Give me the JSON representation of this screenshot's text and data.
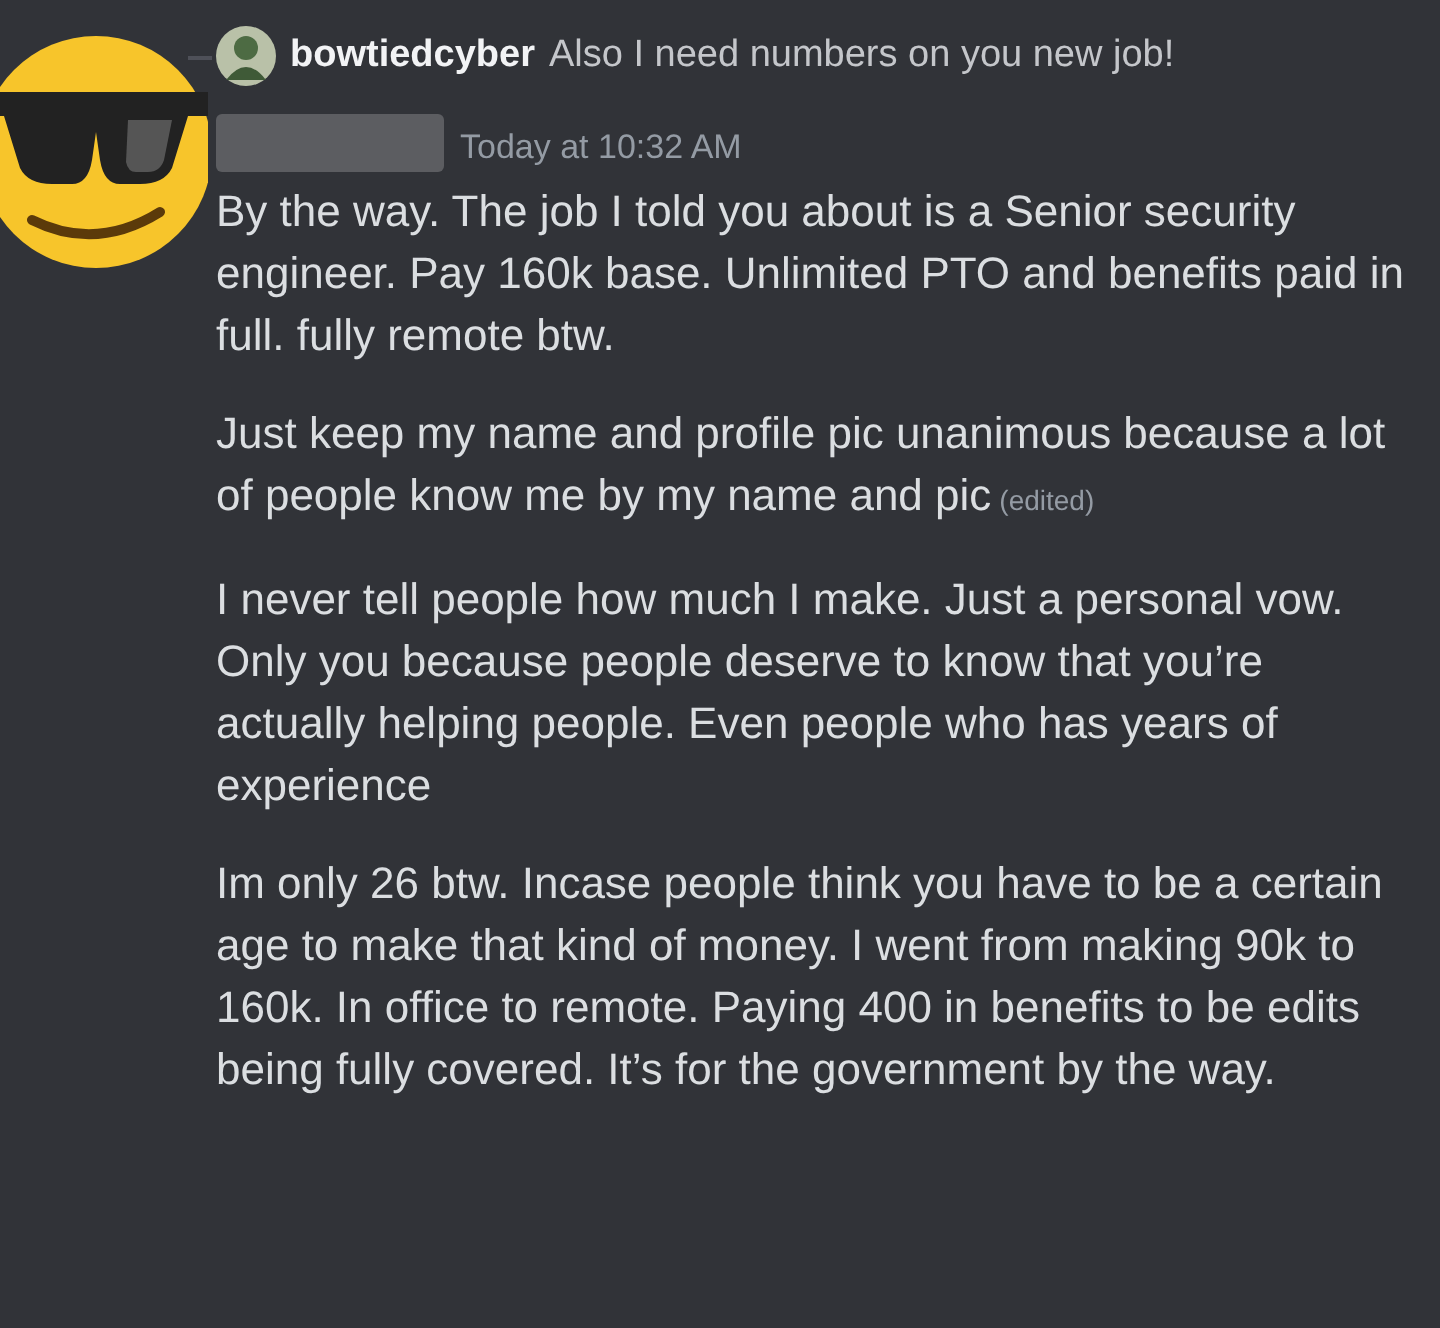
{
  "reply": {
    "author": "bowtiedcyber",
    "text": "Also I need numbers on you new job!"
  },
  "message": {
    "timestamp": "Today at 10:32 AM",
    "paragraphs": [
      {
        "text": "By the way. The job I told you about is a Senior security engineer. Pay 160k base. Unlimited PTO and benefits paid in full. fully remote btw.",
        "edited": false
      },
      {
        "text": "Just keep my name and profile pic unanimous because a lot of people know me by my name and pic",
        "edited": true,
        "edited_label": "(edited)"
      },
      {
        "text": "I never tell people how much I make. Just a personal vow. Only you because people deserve to know that you’re actually helping people. Even people who has years of experience",
        "edited": false
      },
      {
        "text": "Im only 26 btw. Incase people think you have to be a certain age to make that kind of money. I went from making 90k to 160k. In office to remote. Paying 400 in benefits to be edits being fully covered. It’s for the government by the way.",
        "edited": false
      }
    ]
  }
}
